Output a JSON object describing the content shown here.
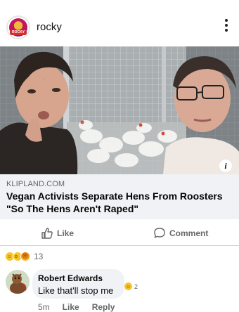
{
  "post": {
    "page_name": "rocky",
    "avatar_caption": "ROCKY"
  },
  "link_preview": {
    "domain": "KLIPLAND.COM",
    "headline": "Vegan Activists Separate Hens From Roosters \"So The Hens Aren't Raped\""
  },
  "actions": {
    "like_label": "Like",
    "comment_label": "Comment"
  },
  "reactions": {
    "icons": [
      "laugh",
      "wow",
      "angry"
    ],
    "count": "13"
  },
  "comment": {
    "author": "Robert Edwards",
    "text": "Like that'll stop me",
    "reaction_count": "2",
    "time": "5m",
    "like_label": "Like",
    "reply_label": "Reply"
  },
  "colors": {
    "secondary_text": "#65676b",
    "bubble_bg": "#f0f2f5",
    "reaction_yellow": "#f7c428",
    "reaction_angry": "#e9710f"
  }
}
